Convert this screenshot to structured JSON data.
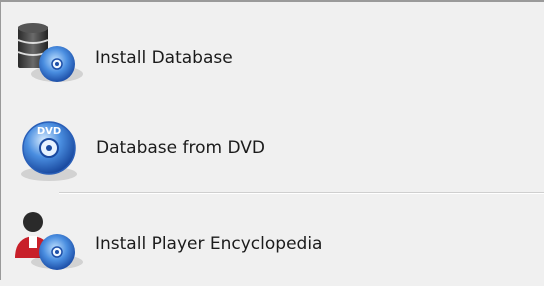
{
  "menu": {
    "items": [
      {
        "label": "Install Database",
        "icon": "database-install-icon"
      },
      {
        "label": "Database from DVD",
        "icon": "dvd-disc-icon"
      },
      {
        "label": "Install Player Encyclopedia",
        "icon": "player-install-icon"
      }
    ]
  },
  "colors": {
    "background": "#f0f0f0",
    "disc_blue": "#3a78d0",
    "database_dark": "#3a3a3a",
    "player_red": "#c8202a"
  }
}
